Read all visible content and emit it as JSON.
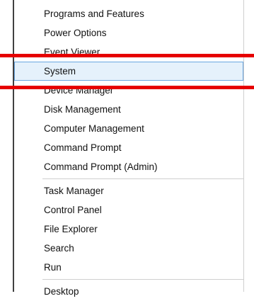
{
  "menu": {
    "items": [
      {
        "label": "Programs and Features"
      },
      {
        "label": "Power Options"
      },
      {
        "label": "Event Viewer"
      },
      {
        "label": "System"
      },
      {
        "label": "Device Manager"
      },
      {
        "label": "Disk Management"
      },
      {
        "label": "Computer Management"
      },
      {
        "label": "Command Prompt"
      },
      {
        "label": "Command Prompt (Admin)"
      },
      {
        "label": "Task Manager"
      },
      {
        "label": "Control Panel"
      },
      {
        "label": "File Explorer"
      },
      {
        "label": "Search"
      },
      {
        "label": "Run"
      },
      {
        "label": "Desktop"
      }
    ]
  },
  "colors": {
    "highlight_line": "#e60000",
    "selection_fill": "#e5f1fb",
    "selection_border": "#6aa6e0"
  }
}
